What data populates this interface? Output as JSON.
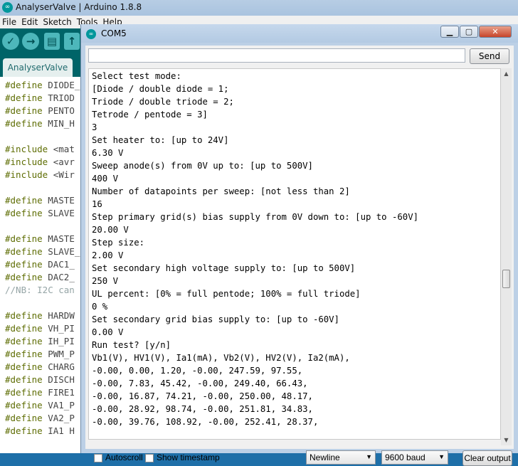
{
  "ide": {
    "title": "AnalyserValve | Arduino 1.8.8",
    "app_icon": "arduino-icon",
    "menu": [
      "File",
      "Edit",
      "Sketch",
      "Tools",
      "Help"
    ],
    "toolbar_icons": [
      "verify-icon",
      "upload-icon",
      "new-icon",
      "open-icon"
    ],
    "tab": "AnalyserValve",
    "code_lines": [
      {
        "kw": "#define",
        "rest": " DIODE_"
      },
      {
        "kw": "#define",
        "rest": " TRIOD"
      },
      {
        "kw": "#define",
        "rest": " PENTO"
      },
      {
        "kw": "#define",
        "rest": " MIN_H"
      },
      {
        "kw": "",
        "rest": ""
      },
      {
        "kw": "#include",
        "rest": " <mat"
      },
      {
        "kw": "#include",
        "rest": " <avr"
      },
      {
        "kw": "#include",
        "rest": " <Wir"
      },
      {
        "kw": "",
        "rest": ""
      },
      {
        "kw": "#define",
        "rest": " MASTE"
      },
      {
        "kw": "#define",
        "rest": " SLAVE"
      },
      {
        "kw": "",
        "rest": ""
      },
      {
        "kw": "#define",
        "rest": " MASTE"
      },
      {
        "kw": "#define",
        "rest": " SLAVE_"
      },
      {
        "kw": "#define",
        "rest": " DAC1_"
      },
      {
        "kw": "#define",
        "rest": " DAC2_"
      },
      {
        "kw": "",
        "rest": "//NB: I2C can",
        "comment": true
      },
      {
        "kw": "",
        "rest": ""
      },
      {
        "kw": "#define",
        "rest": " HARDW"
      },
      {
        "kw": "#define",
        "rest": " VH_PI"
      },
      {
        "kw": "#define",
        "rest": " IH_PI"
      },
      {
        "kw": "#define",
        "rest": " PWM_P"
      },
      {
        "kw": "#define",
        "rest": " CHARG"
      },
      {
        "kw": "#define",
        "rest": " DISCH"
      },
      {
        "kw": "#define",
        "rest": " FIRE1"
      },
      {
        "kw": "#define",
        "rest": " VA1_P"
      },
      {
        "kw": "#define",
        "rest": " VA2_P"
      },
      {
        "kw": "#define",
        "rest": " IA1 H"
      }
    ]
  },
  "serial": {
    "title": "COM5",
    "window_buttons": {
      "minimize": "minimize-icon",
      "maximize": "maximize-icon",
      "close": "close-icon"
    },
    "send_input_value": "",
    "send_label": "Send",
    "output_lines": [
      "Select test mode:",
      "[Diode / double diode = 1;",
      "Triode / double triode = 2;",
      "Tetrode / pentode = 3]",
      "3",
      "Set heater to: [up to 24V]",
      "6.30 V",
      "Sweep anode(s) from 0V up to: [up to 500V]",
      "400 V",
      "Number of datapoints per sweep: [not less than 2]",
      "16",
      "Step primary grid(s) bias supply from 0V down to: [up to -60V]",
      "20.00 V",
      "Step size:",
      "2.00 V",
      "Set secondary high voltage supply to: [up to 500V]",
      "250 V",
      "UL percent: [0% = full pentode; 100% = full triode]",
      "0 %",
      "Set secondary grid bias supply to: [up to -60V]",
      "0.00 V",
      "Run test? [y/n]",
      "Vb1(V), HV1(V), Ia1(mA), Vb2(V), HV2(V), Ia2(mA),",
      "-0.00, 0.00, 1.20, -0.00, 247.59, 97.55,",
      "-0.00, 7.83, 45.42, -0.00, 249.40, 66.43,",
      "-0.00, 16.87, 74.21, -0.00, 250.00, 48.17,",
      "-0.00, 28.92, 98.74, -0.00, 251.81, 34.83,",
      "-0.00, 39.76, 108.92, -0.00, 252.41, 28.37,"
    ],
    "autoscroll_label": "Autoscroll",
    "autoscroll_checked": false,
    "timestamp_label": "Show timestamp",
    "timestamp_checked": false,
    "line_ending": "Newline",
    "baud_rate": "9600 baud",
    "clear_label": "Clear output"
  }
}
